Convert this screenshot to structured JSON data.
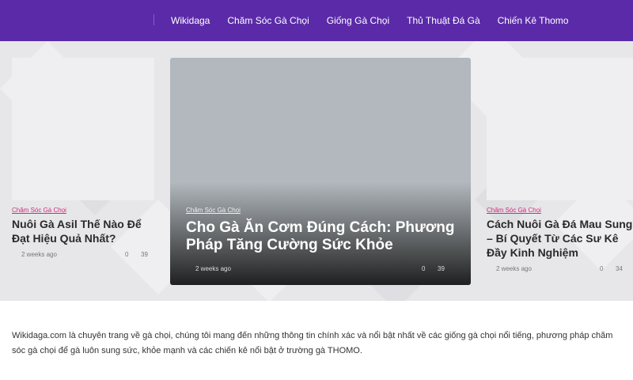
{
  "nav": {
    "items": [
      {
        "label": "Wikidaga"
      },
      {
        "label": "Chăm Sóc Gà Chọi"
      },
      {
        "label": "Giống Gà Chọi"
      },
      {
        "label": "Thủ Thuật Đá Gà"
      },
      {
        "label": "Chiến Kê Thomo"
      }
    ]
  },
  "hero": {
    "left": {
      "category": "Chăm Sóc Gà Chọi",
      "title": "Nuôi Gà Asil Thế Nào Để Đạt Hiệu Quả Nhất?",
      "date": "2 weeks ago",
      "comments": "0",
      "views": "39"
    },
    "main": {
      "category": "Chăm Sóc Gà Chọi",
      "title": "Cho Gà Ăn Cơm Đúng Cách: Phương Pháp Tăng Cường Sức Khỏe",
      "date": "2 weeks ago",
      "comments": "0",
      "views": "39"
    },
    "right": {
      "category": "Chăm Sóc Gà Chọi",
      "title": "Cách Nuôi Gà Đá Mau Sung – Bí Quyết Từ Các Sư Kê Đầy Kinh Nghiệm",
      "date": "2 weeks ago",
      "comments": "0",
      "views": "34"
    }
  },
  "about": {
    "text": "Wikidaga.com là chuyên trang về gà chọi, chúng tôi mang đến những thông tin chính xác và nổi bật nhất về các giống gà chọi nổi tiếng, phương pháp chăm sóc gà chọi để gà luôn sung sức, khỏe mạnh và các chiến kê nổi bật ở trường gà THOMO."
  },
  "colors": {
    "nav_bg": "#5b2aa8",
    "category_pink": "#d2287a",
    "hero_bg": "#e7e7ea"
  }
}
